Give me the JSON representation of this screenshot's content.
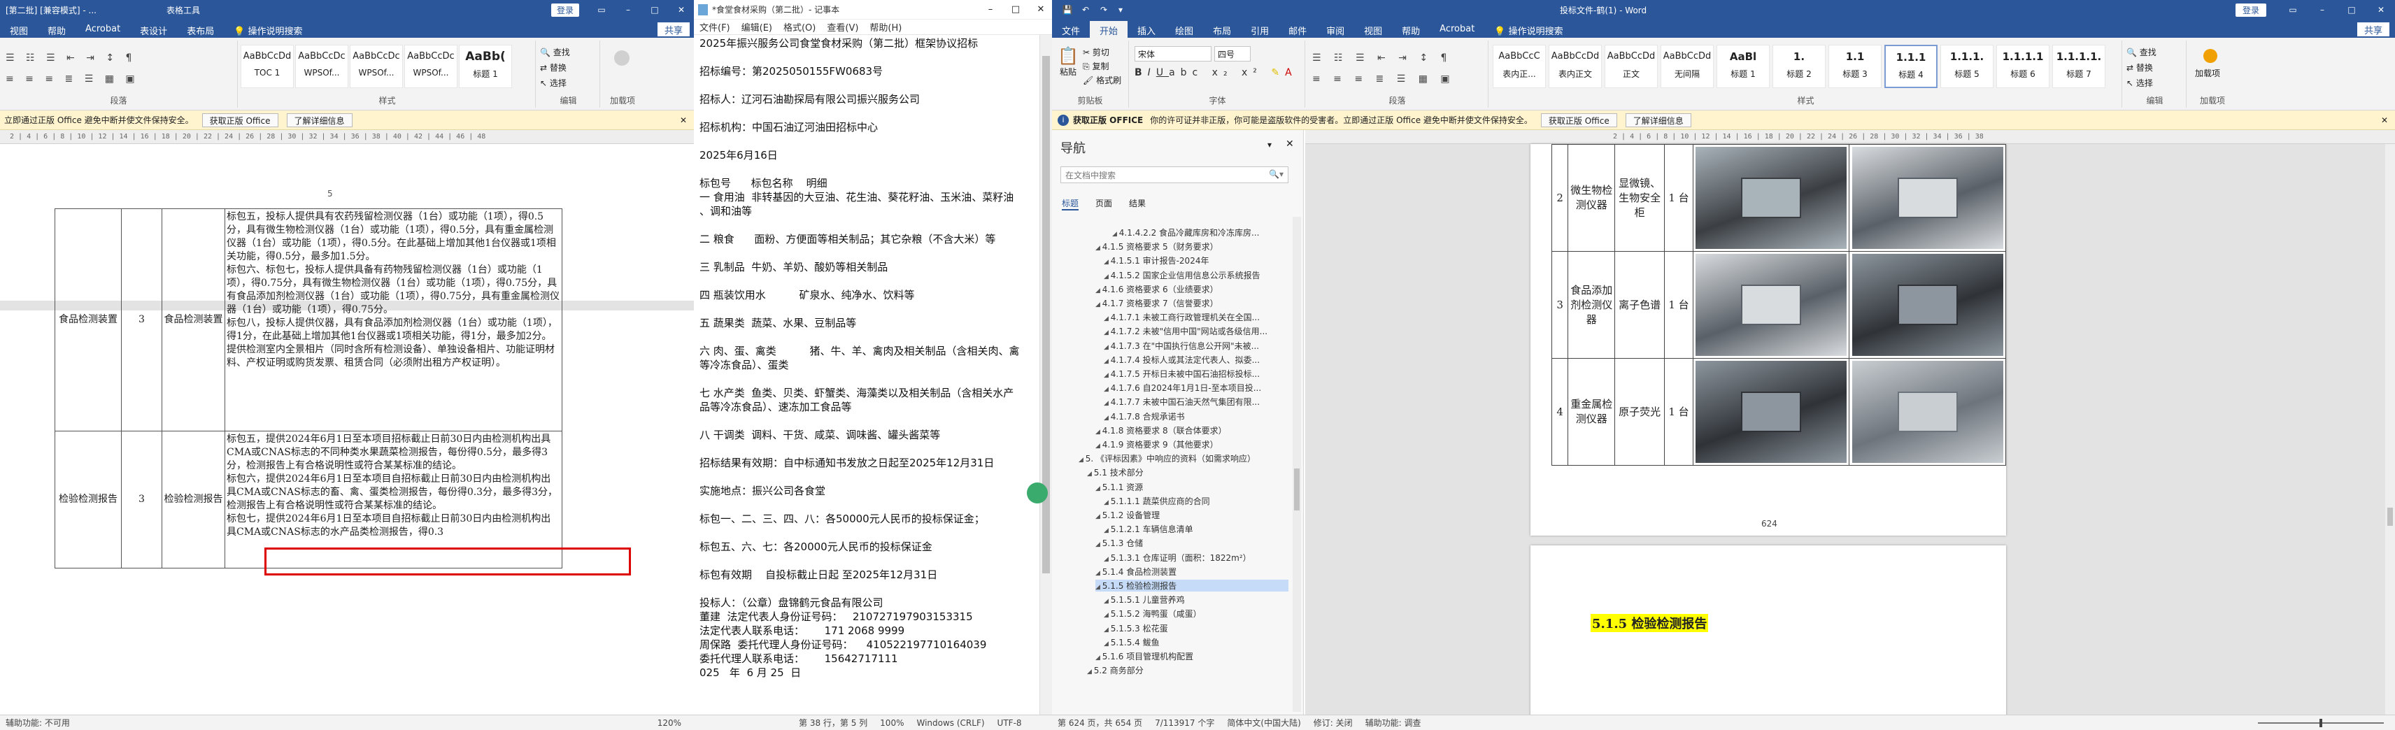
{
  "left_word": {
    "title": "[第二批] [兼容模式] - ...",
    "tools": "表格工具",
    "login": "登录",
    "share": "共享",
    "tabs": [
      "视图",
      "帮助",
      "Acrobat",
      "表设计",
      "表布局",
      "操作说明搜索"
    ],
    "styles": [
      {
        "p": "AaBbCcDd",
        "n": "TOC 1"
      },
      {
        "p": "AaBbCcDc",
        "n": "WPSOf..."
      },
      {
        "p": "AaBbCcDc",
        "n": "WPSOf..."
      },
      {
        "p": "AaBbCcDc",
        "n": "WPSOf..."
      },
      {
        "p": "AaBb(",
        "n": "标题 1"
      }
    ],
    "groups": {
      "para": "段落",
      "styles": "样式",
      "edit": "编辑",
      "addin": "加载项"
    },
    "edit_btns": [
      "查找",
      "替换",
      "选择"
    ],
    "message": "立即通过正版 Office 避免中断并使文件保持安全。",
    "get_office": "获取正版 Office",
    "learn_more": "了解详细信息",
    "ruler": "2 | 4 | 6 | 8 | 10 | 12 | 14 | 16 | 18 | 20 | 22 | 24 | 26 | 28 | 30 | 32 | 34 | 36 | 38 | 40 | 42 | 44 | 46 | 48",
    "page_number": "5",
    "rows": [
      {
        "name": "食品检测装置",
        "qty": "3",
        "item": "食品检测装置",
        "text": "标包五，投标人提供具有农药残留检测仪器（1台）或功能（1项），得0.5分，具有微生物检测仪器（1台）或功能（1项），得0.5分，具有重金属检测仪器（1台）或功能（1项），得0.5分。在此基础上增加其他1台仪器或1项相关功能，得0.5分，最多加1.5分。\n标包六、标包七，投标人提供具备有药物残留检测仪器（1台）或功能（1项），得0.75分，具有微生物检测仪器（1台）或功能（1项），得0.75分，具有食品添加剂检测仪器（1台）或功能（1项），得0.75分，具有重金属检测仪器（1台）或功能（1项），得0.75分。\n标包八，投标人提供仪器，具有食品添加剂检测仪器（1台）或功能（1项），得1分，在此基础上增加其他1台仪器或1项相关功能，得1分，最多加2分。\n提供检测室内全景相片（同时含所有检测设备）、单独设备相片、功能证明材料、产权证明或购货发票、租赁合同（必须附出租方产权证明）。"
      },
      {
        "name": "检验检测报告",
        "qty": "3",
        "item": "检验检测报告",
        "text": "标包五，提供2024年6月1日至本项目招标截止日前30日内由检测机构出具CMA或CNAS标志的不同种类水果蔬菜检测报告，每份得0.5分，最多得3分，检测报告上有合格说明性或符合某某标准的结论。\n标包六，提供2024年6月1日至本项目自招标截止日前30日内由检测机构出具CMA或CNAS标志的畜、禽、蛋类检测报告，每份得0.3分，最多得3分，检测报告上有合格说明性或符合某某标准的结论。\n标包七，提供2024年6月1日至本项目自招标截止日前30日内由检测机构出具CMA或CNAS标志的水产品类检测报告，得0.3"
      }
    ],
    "status": [
      "第 38 行，第 5 列"
    ],
    "status_left": "辅助功能: 不可用",
    "zoom": "120%"
  },
  "notepad": {
    "title": "*食堂食材采购（第二批）- 记事本",
    "menu": [
      "文件(F)",
      "编辑(E)",
      "格式(O)",
      "查看(V)",
      "帮助(H)"
    ],
    "lines": [
      "2025年振兴服务公司食堂食材采购（第二批）框架协议招标",
      "",
      "招标编号：第2025050155FW0683号",
      "",
      "招标人：辽河石油勘探局有限公司振兴服务公司",
      "",
      "招标机构：中国石油辽河油田招标中心",
      "",
      "2025年6月16日",
      "",
      "标包号      标包名称    明细",
      "一 食用油  非转基因的大豆油、花生油、葵花籽油、玉米油、菜籽油",
      "、调和油等",
      "",
      "二 粮食      面粉、方便面等相关制品；其它杂粮（不含大米）等",
      "",
      "三 乳制品  牛奶、羊奶、酸奶等相关制品",
      "",
      "四 瓶装饮用水          矿泉水、纯净水、饮料等",
      "",
      "五 蔬果类  蔬菜、水果、豆制品等",
      "",
      "六 肉、蛋、禽类          猪、牛、羊、禽肉及相关制品（含相关肉、禽",
      "等冷冻食品）、蛋类",
      "",
      "七 水产类  鱼类、贝类、虾蟹类、海藻类以及相关制品（含相关水产",
      "品等冷冻食品）、速冻加工食品等",
      "",
      "八 干调类  调料、干货、咸菜、调味酱、罐头酱菜等",
      "",
      "招标结果有效期：自中标通知书发放之日起至2025年12月31日",
      "",
      "实施地点：振兴公司各食堂",
      "",
      "标包一、二、三、四、八：各50000元人民币的投标保证金；",
      "",
      "标包五、六、七：各20000元人民币的投标保证金",
      "",
      "标包有效期    自投标截止日起 至2025年12月31日",
      "",
      "投标人：（公章）盘锦鹤元食品有限公司",
      "董建  法定代表人身份证号码：   210727197903153315",
      "法定代表人联系电话：      171 2068 9999",
      "周保路  委托代理人身份证号码：    410522197710164039",
      "委托代理人联系电话：      15642717111",
      "025   年  6 月 25  日"
    ],
    "status": [
      "第 38 行，第 5 列",
      "100%",
      "Windows (CRLF)",
      "UTF-8"
    ]
  },
  "right_word": {
    "title": "投标文件-鹤(1) - Word",
    "login": "登录",
    "share": "共享",
    "tabs": [
      "文件",
      "开始",
      "插入",
      "绘图",
      "布局",
      "引用",
      "邮件",
      "审阅",
      "视图",
      "帮助",
      "Acrobat",
      "操作说明搜索"
    ],
    "clipboard": {
      "paste": "粘贴",
      "cut": "剪切",
      "copy": "复制",
      "painter": "格式刷",
      "label": "剪贴板"
    },
    "font": {
      "name": "宋体",
      "size": "四号",
      "label": "字体"
    },
    "para_label": "段落",
    "styles_label": "样式",
    "styles": [
      {
        "p": "AaBbCcC",
        "n": "表内正..."
      },
      {
        "p": "AaBbCcDd",
        "n": "表内正文"
      },
      {
        "p": "AaBbCcDd",
        "n": "正文"
      },
      {
        "p": "AaBbCcDd",
        "n": "无间隔"
      },
      {
        "p": "AaBl",
        "n": "标题 1"
      },
      {
        "p": "1.",
        "n": "标题 2"
      },
      {
        "p": "1.1",
        "n": "标题 3"
      },
      {
        "p": "1.1.1",
        "n": "标题 4"
      },
      {
        "p": "1.1.1.",
        "n": "标题 5"
      },
      {
        "p": "1.1.1.1",
        "n": "标题 6"
      },
      {
        "p": "1.1.1.1.",
        "n": "标题 7"
      }
    ],
    "edit_btns": [
      "查找",
      "替换",
      "选择"
    ],
    "edit_label": "编辑",
    "addin": "加载项",
    "addin_label": "加载项",
    "msg_bold": "获取正版 OFFICE",
    "message": "你的许可证并非正版，你可能是盗版软件的受害者。立即通过正版 Office 避免中断并使文件保持安全。",
    "get_office": "获取正版 Office",
    "learn_more": "了解详细信息",
    "nav": {
      "title": "导航",
      "search": "在文档中搜索",
      "tabs": [
        "标题",
        "页面",
        "结果"
      ],
      "items": [
        {
          "t": "4.1.4.2.2 食品冷藏库房和冷冻库房...",
          "l": 4
        },
        {
          "t": "4.1.5 资格要求 5（财务要求）",
          "l": 2
        },
        {
          "t": "4.1.5.1 审计报告-2024年",
          "l": 3
        },
        {
          "t": "4.1.5.2 国家企业信用信息公示系统报告",
          "l": 3
        },
        {
          "t": "4.1.6 资格要求 6（业绩要求）",
          "l": 2
        },
        {
          "t": "4.1.7 资格要求 7（信誉要求）",
          "l": 2
        },
        {
          "t": "4.1.7.1 未被工商行政管理机关在全国...",
          "l": 3
        },
        {
          "t": "4.1.7.2 未被\"信用中国\"网站或各级信用...",
          "l": 3
        },
        {
          "t": "4.1.7.3 在\"中国执行信息公开网\"未被...",
          "l": 3
        },
        {
          "t": "4.1.7.4 投标人或其法定代表人、拟委...",
          "l": 3
        },
        {
          "t": "4.1.7.5 开标日未被中国石油招标投标...",
          "l": 3
        },
        {
          "t": "4.1.7.6 自2024年1月1日-至本项目投...",
          "l": 3
        },
        {
          "t": "4.1.7.7 未被中国石油天然气集团有限...",
          "l": 3
        },
        {
          "t": "4.1.7.8 合规承诺书",
          "l": 3
        },
        {
          "t": "4.1.8 资格要求 8（联合体要求）",
          "l": 2
        },
        {
          "t": "4.1.9 资格要求 9（其他要求）",
          "l": 2
        },
        {
          "t": "5. 《评标因素》中响应的资料（如需求响应）",
          "l": 0
        },
        {
          "t": "5.1 技术部分",
          "l": 1
        },
        {
          "t": "5.1.1 资源",
          "l": 2
        },
        {
          "t": "5.1.1.1 蔬菜供应商的合同",
          "l": 3
        },
        {
          "t": "5.1.2 设备管理",
          "l": 2
        },
        {
          "t": "5.1.2.1 车辆信息清单",
          "l": 3
        },
        {
          "t": "5.1.3 仓储",
          "l": 2
        },
        {
          "t": "5.1.3.1 仓库证明（面积：1822m²）",
          "l": 3
        },
        {
          "t": "5.1.4 食品检测装置",
          "l": 2
        },
        {
          "t": "5.1.5 检验检测报告",
          "l": 2,
          "sel": true
        },
        {
          "t": "5.1.5.1 儿童营养鸡",
          "l": 3
        },
        {
          "t": "5.1.5.2 海鸭蛋（咸蛋）",
          "l": 3
        },
        {
          "t": "5.1.5.3 松花蛋",
          "l": 3
        },
        {
          "t": "5.1.5.4 鲅鱼",
          "l": 3
        },
        {
          "t": "5.1.6 项目管理机构配置",
          "l": 2
        },
        {
          "t": "5.2 商务部分",
          "l": 1
        }
      ]
    },
    "ruler": "2 | 4 | 6 | 8 | 10 | 12 | 14 | 16 | 18 | 20 | 22 | 24 | 26 | 28 | 30 | 32 | 34 | 36 | 38",
    "table": [
      {
        "no": "2",
        "name": "微生物检测仪器",
        "func": "显微镜、生物安全柜",
        "qty": "1 台"
      },
      {
        "no": "3",
        "name": "食品添加剂检测仪器",
        "func": "离子色谱",
        "qty": "1 台"
      },
      {
        "no": "4",
        "name": "重金属检测仪器",
        "func": "原子荧光",
        "qty": "1 台"
      }
    ],
    "page_num": "624",
    "heading": "5.1.5  检验检测报告",
    "status": [
      "第 624 页，共 654 页",
      "7/113917 个字",
      "简体中文(中国大陆)",
      "修订: 关闭",
      "辅助功能: 调查"
    ]
  }
}
